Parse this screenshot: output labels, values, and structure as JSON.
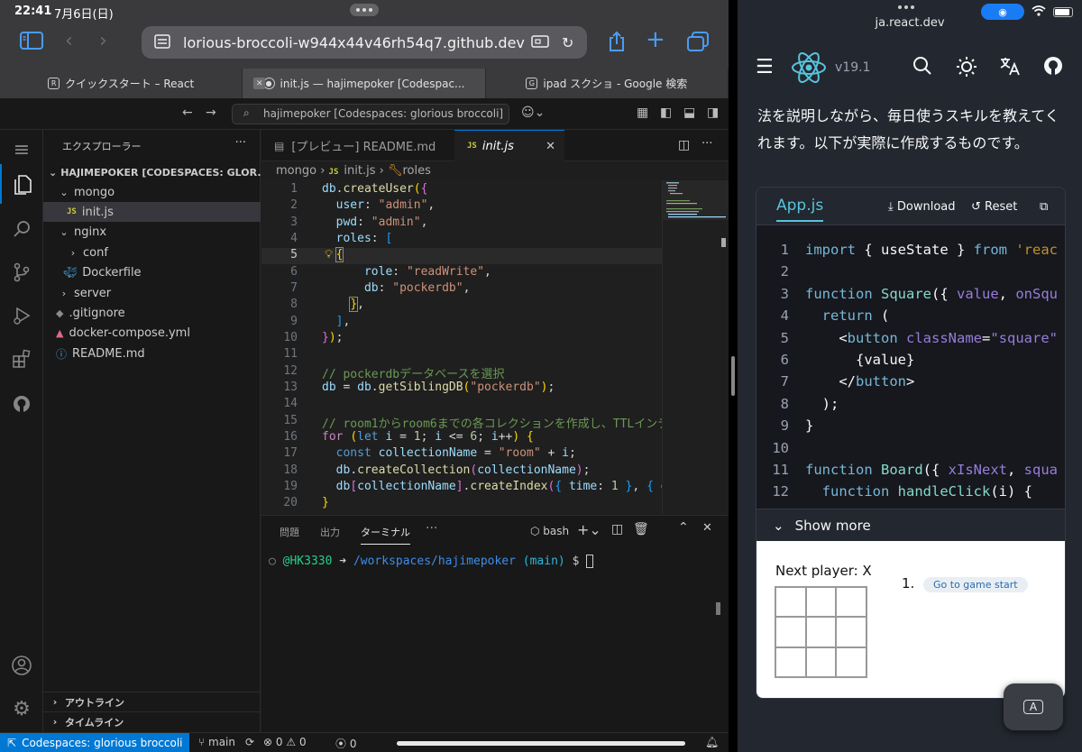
{
  "ios_status": {
    "time": "22:41",
    "date": "7月6日(日)"
  },
  "safari": {
    "url": "lorious-broccoli-w944x44v46rh54q7.github.dev",
    "tabs": [
      {
        "favicon": "R",
        "title": "クイックスタート – React"
      },
      {
        "favicon": "gh",
        "title": "init.js — hajimepoker [Codespac..."
      },
      {
        "favicon": "G",
        "title": "ipad スクショ - Google 検索"
      }
    ]
  },
  "vscode": {
    "command_center": "hajimepoker [Codespaces: glorious broccoli]",
    "explorer": {
      "title": "エクスプローラー",
      "root": "HAJIMEPOKER [CODESPACES: GLOR...",
      "items": [
        {
          "label": "mongo",
          "type": "folder-open",
          "indent": 1
        },
        {
          "label": "init.js",
          "type": "js",
          "indent": 2
        },
        {
          "label": "nginx",
          "type": "folder-open",
          "indent": 1
        },
        {
          "label": "conf",
          "type": "folder",
          "indent": 2
        },
        {
          "label": "Dockerfile",
          "type": "docker",
          "indent": 2
        },
        {
          "label": "server",
          "type": "folder",
          "indent": 1
        },
        {
          "label": ".gitignore",
          "type": "git",
          "indent": 1
        },
        {
          "label": "docker-compose.yml",
          "type": "docker",
          "indent": 1
        },
        {
          "label": "README.md",
          "type": "info",
          "indent": 1
        }
      ],
      "outline": "アウトライン",
      "timeline": "タイムライン"
    },
    "editor_tabs": [
      {
        "label": "[プレビュー] README.md"
      },
      {
        "label": "init.js"
      }
    ],
    "breadcrumb": {
      "folder": "mongo",
      "file": "init.js",
      "symbol": "roles"
    },
    "panel": {
      "tabs": [
        "問題",
        "出力",
        "ターミナル"
      ],
      "shell": "bash",
      "prompt_user": "@HK3330",
      "prompt_path": "/workspaces/hajimepoker",
      "prompt_branch": "(main)"
    },
    "statusbar": {
      "remote": "Codespaces: glorious broccoli",
      "branch": "main",
      "errors": "0",
      "warnings": "0",
      "ports": "0"
    }
  },
  "react_site": {
    "domain": "ja.react.dev",
    "version": "v19.1",
    "prose": "法を説明しながら、毎日使うスキルを教えてくれます。以下が実際に作成するものです。",
    "sandbox": {
      "tab": "App.js",
      "download": "Download",
      "reset": "Reset",
      "show_more": "Show more",
      "next_player": "Next player: X",
      "history_num": "1.",
      "history_button": "Go to game start"
    },
    "float_button": "A"
  }
}
